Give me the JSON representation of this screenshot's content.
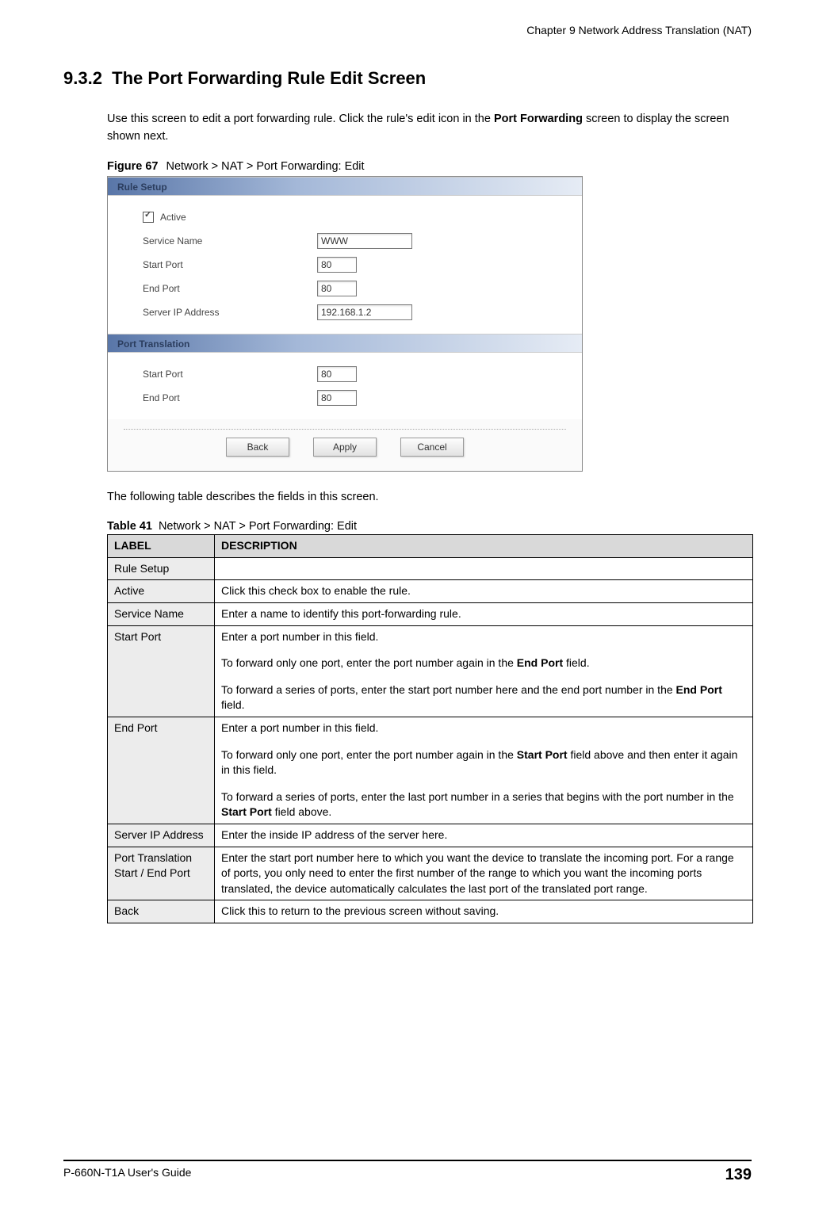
{
  "header": {
    "chapter": "Chapter 9 Network Address Translation (NAT)"
  },
  "section": {
    "number": "9.3.2",
    "title": "The Port Forwarding Rule Edit Screen"
  },
  "intro": {
    "text_before_bold": "Use this screen to edit a port forwarding rule. Click the rule's edit icon in the ",
    "bold1": "Port Forwarding",
    "text_after": " screen to display the screen shown next."
  },
  "figure": {
    "label": "Figure 67",
    "caption": "Network > NAT > Port Forwarding: Edit"
  },
  "screenshot": {
    "section1_title": "Rule Setup",
    "active_label": "Active",
    "active_checked": true,
    "service_name_label": "Service Name",
    "service_name_value": "WWW",
    "start_port_label": "Start Port",
    "start_port_value": "80",
    "end_port_label": "End Port",
    "end_port_value": "80",
    "server_ip_label": "Server IP Address",
    "server_ip_value": "192.168.1.2",
    "section2_title": "Port Translation",
    "pt_start_port_label": "Start Port",
    "pt_start_port_value": "80",
    "pt_end_port_label": "End Port",
    "pt_end_port_value": "80",
    "buttons": {
      "back": "Back",
      "apply": "Apply",
      "cancel": "Cancel"
    }
  },
  "table_intro": "The following table describes the fields in this screen.",
  "table": {
    "label": "Table 41",
    "caption": "Network > NAT > Port Forwarding: Edit",
    "header_label": "LABEL",
    "header_desc": "DESCRIPTION",
    "rows": {
      "rule_setup": {
        "label": "Rule Setup",
        "desc": ""
      },
      "active": {
        "label": "Active",
        "desc": "Click this check box to enable the rule."
      },
      "service_name": {
        "label": "Service Name",
        "desc": "Enter a name to identify this port-forwarding rule."
      },
      "start_port": {
        "label": "Start Port",
        "p1": "Enter a port number in this field.",
        "p2_a": "To forward only one port, enter the port number again in the ",
        "p2_b": "End Port",
        "p2_c": " field.",
        "p3_a": "To forward a series of ports, enter the start port number here and the end port number in the ",
        "p3_b": "End Port",
        "p3_c": " field."
      },
      "end_port": {
        "label": "End Port",
        "p1": "Enter a port number in this field.",
        "p2_a": "To forward only one port, enter the port number again in the ",
        "p2_b": "Start Port",
        "p2_c": " field above and then enter it again in this field.",
        "p3_a": "To forward a series of ports, enter the last port number in a series that begins with the port number in the ",
        "p3_b": "Start Port",
        "p3_c": " field above."
      },
      "server_ip": {
        "label": "Server IP Address",
        "desc": "Enter the inside IP address of the server here."
      },
      "port_trans": {
        "label": "Port Translation Start / End Port",
        "desc": "Enter the start port number here to which you want the device to translate the incoming port. For a range of ports, you only need to enter the first number of the range to which you want the incoming ports translated, the device automatically calculates the last port of the translated port range."
      },
      "back": {
        "label": "Back",
        "desc": "Click this to return to the previous screen without saving."
      }
    }
  },
  "footer": {
    "guide": "P-660N-T1A User's Guide",
    "page": "139"
  }
}
